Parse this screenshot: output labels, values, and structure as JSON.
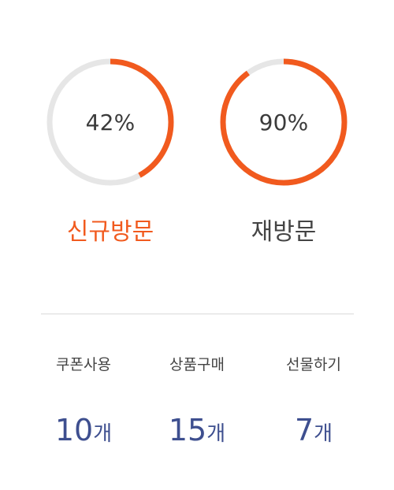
{
  "gauges": [
    {
      "percent": 42,
      "percent_text": "42%",
      "label": "신규방문",
      "active": true
    },
    {
      "percent": 90,
      "percent_text": "90%",
      "label": "재방문",
      "active": false
    }
  ],
  "stats": [
    {
      "label": "쿠폰사용",
      "value": "10",
      "unit": "개"
    },
    {
      "label": "상품구매",
      "value": "15",
      "unit": "개"
    },
    {
      "label": "선물하기",
      "value": "7",
      "unit": "개"
    }
  ],
  "colors": {
    "accent": "#f15a1e",
    "track": "#e6e6e6",
    "value": "#3e4f8f"
  }
}
